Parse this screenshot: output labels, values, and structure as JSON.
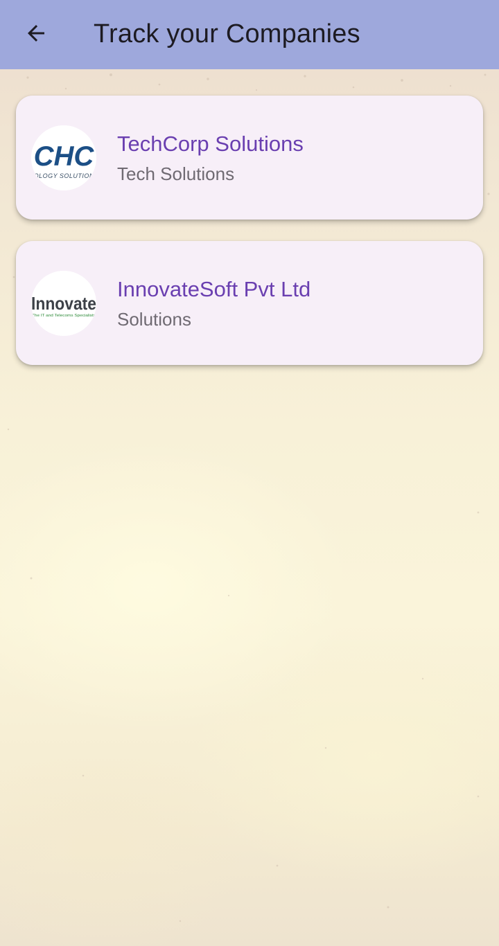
{
  "appbar": {
    "title": "Track your Companies",
    "back_icon": "arrow-left-icon",
    "background": "#9ea8dc"
  },
  "companies": [
    {
      "name": "TechCorp Solutions",
      "category": "Tech Solutions",
      "logo_text": "CHC",
      "logo_subtext": "NOLOGY SOLUTIONS"
    },
    {
      "name": "InnovateSoft Pvt Ltd",
      "category": "Solutions",
      "logo_text": "Innovate",
      "logo_subtext": "The IT and Telecoms Specialists"
    }
  ],
  "colors": {
    "title_accent": "#6a3fb0",
    "subtitle": "#6f6a72",
    "card_background": "#f7eff8",
    "techcorp_logo_blue": "#1c4f86",
    "innovate_logo_gray": "#3d4148",
    "innovate_logo_green": "#2e8b3a"
  }
}
